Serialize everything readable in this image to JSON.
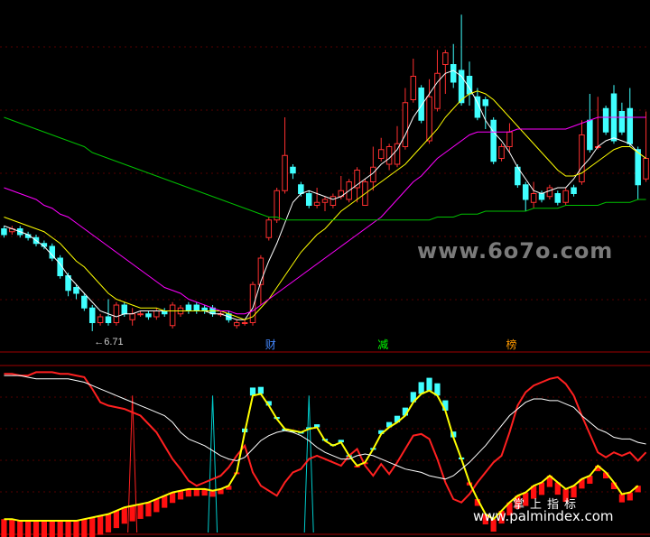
{
  "chart_data": [
    {
      "type": "candlestick",
      "title": "",
      "xlabel": "",
      "ylabel": "",
      "ylim": [
        6.0,
        18.0
      ],
      "grid": true,
      "low_annotation": "6.71",
      "candles": [
        [
          10.2,
          10.0,
          10.3,
          9.9
        ],
        [
          10.1,
          10.2,
          10.3,
          10.0
        ],
        [
          10.2,
          10.0,
          10.3,
          9.9
        ],
        [
          10.0,
          9.9,
          10.1,
          9.8
        ],
        [
          9.9,
          9.7,
          10.0,
          9.6
        ],
        [
          9.7,
          9.6,
          9.8,
          9.5
        ],
        [
          9.6,
          9.2,
          9.7,
          9.1
        ],
        [
          9.2,
          8.6,
          9.3,
          8.5
        ],
        [
          8.6,
          8.1,
          8.7,
          7.9
        ],
        [
          8.2,
          8.0,
          8.3,
          7.8
        ],
        [
          7.9,
          7.5,
          8.0,
          7.4
        ],
        [
          7.5,
          7.0,
          7.6,
          6.71
        ],
        [
          7.0,
          7.2,
          7.3,
          6.9
        ],
        [
          7.2,
          7.0,
          7.8,
          6.9
        ],
        [
          7.0,
          7.6,
          7.7,
          6.9
        ],
        [
          7.6,
          7.3,
          7.7,
          7.2
        ],
        [
          7.1,
          7.3,
          7.5,
          6.9
        ],
        [
          7.3,
          7.3,
          7.4,
          7.2
        ],
        [
          7.3,
          7.2,
          7.4,
          7.1
        ],
        [
          7.2,
          7.4,
          7.5,
          7.1
        ],
        [
          7.4,
          7.3,
          7.5,
          7.2
        ],
        [
          6.9,
          7.6,
          7.7,
          6.8
        ],
        [
          7.3,
          7.5,
          7.6,
          7.2
        ],
        [
          7.6,
          7.4,
          7.7,
          7.3
        ],
        [
          7.6,
          7.4,
          7.7,
          7.3
        ],
        [
          7.5,
          7.4,
          7.6,
          7.3
        ],
        [
          7.5,
          7.3,
          7.6,
          7.2
        ],
        [
          7.3,
          7.3,
          7.4,
          7.2
        ],
        [
          7.3,
          7.1,
          7.4,
          7.0
        ],
        [
          6.9,
          7.0,
          7.1,
          6.8
        ],
        [
          7.0,
          7.0,
          7.1,
          6.9
        ],
        [
          7.0,
          8.3,
          8.4,
          6.9
        ],
        [
          8.3,
          9.2,
          9.3,
          7.6
        ],
        [
          9.9,
          10.5,
          10.6,
          9.8
        ],
        [
          10.5,
          11.5,
          11.6,
          10.4
        ],
        [
          11.5,
          12.7,
          14.0,
          11.4
        ],
        [
          12.3,
          12.1,
          12.4,
          11.9
        ],
        [
          11.7,
          11.4,
          11.8,
          11.3
        ],
        [
          11.4,
          11.0,
          11.5,
          10.9
        ],
        [
          11.0,
          11.1,
          11.6,
          10.9
        ],
        [
          11.1,
          11.2,
          11.3,
          10.8
        ],
        [
          11.0,
          11.3,
          11.4,
          10.9
        ],
        [
          11.3,
          11.5,
          12.0,
          11.2
        ],
        [
          11.2,
          11.8,
          11.9,
          11.1
        ],
        [
          11.6,
          12.2,
          12.3,
          11.1
        ],
        [
          11.0,
          11.8,
          11.9,
          11.0
        ],
        [
          11.8,
          12.3,
          13.0,
          11.5
        ],
        [
          12.6,
          12.9,
          13.3,
          12.5
        ],
        [
          12.4,
          13.0,
          13.1,
          12.2
        ],
        [
          12.4,
          13.1,
          13.7,
          12.3
        ],
        [
          13.0,
          14.5,
          15.0,
          12.9
        ],
        [
          14.6,
          15.4,
          16.0,
          14.5
        ],
        [
          15.0,
          13.9,
          15.1,
          13.8
        ],
        [
          13.2,
          14.7,
          15.3,
          13.1
        ],
        [
          14.3,
          15.5,
          16.3,
          14.2
        ],
        [
          15.8,
          16.2,
          16.3,
          14.8
        ],
        [
          15.8,
          15.2,
          16.5,
          15.0
        ],
        [
          15.6,
          14.5,
          17.5,
          14.4
        ],
        [
          15.4,
          14.8,
          15.9,
          14.4
        ],
        [
          14.7,
          14.0,
          15.0,
          13.9
        ],
        [
          14.6,
          14.4,
          14.7,
          13.6
        ],
        [
          13.9,
          12.5,
          14.0,
          12.4
        ],
        [
          12.6,
          13.0,
          13.1,
          12.5
        ],
        [
          13.0,
          13.5,
          13.8,
          12.8
        ],
        [
          12.3,
          11.7,
          12.4,
          11.6
        ],
        [
          11.7,
          11.2,
          11.8,
          10.8
        ],
        [
          11.1,
          11.4,
          11.8,
          10.9
        ],
        [
          11.4,
          11.2,
          11.5,
          11.1
        ],
        [
          11.3,
          11.6,
          11.7,
          11.2
        ],
        [
          11.4,
          11.1,
          11.5,
          11.0
        ],
        [
          11.1,
          11.5,
          11.6,
          11.0
        ],
        [
          11.6,
          11.4,
          11.7,
          11.3
        ],
        [
          11.8,
          13.4,
          13.9,
          11.7
        ],
        [
          13.9,
          12.9,
          14.8,
          12.8
        ],
        [
          13.0,
          13.0,
          14.7,
          12.9
        ],
        [
          14.3,
          13.5,
          14.4,
          13.4
        ],
        [
          14.8,
          13.2,
          15.1,
          13.1
        ],
        [
          14.2,
          13.5,
          14.5,
          13.4
        ],
        [
          14.3,
          13.1,
          15.0,
          13.0
        ],
        [
          12.9,
          11.7,
          13.0,
          11.2
        ],
        [
          11.9,
          12.6,
          14.2,
          11.8
        ]
      ],
      "ma_lines": [
        {
          "color": "#ffffff",
          "values": [
            10.3,
            10.2,
            10.1,
            10.0,
            9.8,
            9.6,
            9.3,
            9.0,
            8.6,
            8.3,
            8.0,
            7.7,
            7.4,
            7.3,
            7.2,
            7.3,
            7.3,
            7.4,
            7.4,
            7.4,
            7.4,
            7.4,
            7.4,
            7.4,
            7.4,
            7.4,
            7.3,
            7.3,
            7.2,
            7.1,
            7.1,
            7.5,
            8.4,
            9.1,
            9.7,
            10.4,
            11.1,
            11.4,
            11.5,
            11.4,
            11.3,
            11.2,
            11.3,
            11.5,
            11.7,
            11.9,
            12.1,
            12.4,
            12.6,
            12.9,
            13.4,
            14.0,
            14.4,
            14.8,
            15.2,
            15.5,
            15.6,
            15.4,
            15.0,
            14.5,
            13.9,
            13.5,
            13.2,
            12.8,
            12.3,
            11.9,
            11.5,
            11.4,
            11.5,
            11.6,
            11.6,
            11.9,
            12.3,
            12.6,
            13.0,
            13.2,
            13.3,
            13.2,
            13.1,
            12.8,
            12.6
          ]
        },
        {
          "color": "#ffff00",
          "values": [
            10.6,
            10.5,
            10.4,
            10.3,
            10.2,
            10.1,
            9.9,
            9.7,
            9.4,
            9.1,
            8.9,
            8.6,
            8.3,
            8.0,
            7.8,
            7.7,
            7.6,
            7.5,
            7.5,
            7.5,
            7.4,
            7.4,
            7.4,
            7.4,
            7.4,
            7.4,
            7.4,
            7.4,
            7.3,
            7.2,
            7.1,
            7.2,
            7.5,
            7.8,
            8.2,
            8.6,
            9.0,
            9.4,
            9.7,
            10.0,
            10.2,
            10.5,
            10.8,
            11.0,
            11.2,
            11.4,
            11.6,
            11.8,
            12.0,
            12.2,
            12.4,
            12.7,
            13.0,
            13.3,
            13.6,
            14.0,
            14.3,
            14.6,
            14.8,
            14.9,
            14.8,
            14.6,
            14.3,
            14.0,
            13.7,
            13.4,
            13.1,
            12.8,
            12.5,
            12.2,
            12.0,
            12.0,
            12.1,
            12.3,
            12.5,
            12.7,
            12.9,
            13.0,
            13.0,
            12.8,
            12.6
          ]
        },
        {
          "color": "#ff00ff",
          "values": [
            11.6,
            11.5,
            11.4,
            11.3,
            11.2,
            11.0,
            10.9,
            10.7,
            10.6,
            10.4,
            10.2,
            10.0,
            9.8,
            9.6,
            9.4,
            9.2,
            9.0,
            8.8,
            8.6,
            8.4,
            8.2,
            8.1,
            8.0,
            7.8,
            7.7,
            7.6,
            7.5,
            7.4,
            7.4,
            7.3,
            7.3,
            7.4,
            7.6,
            7.8,
            8.0,
            8.2,
            8.4,
            8.6,
            8.8,
            9.0,
            9.2,
            9.4,
            9.6,
            9.8,
            10.0,
            10.2,
            10.4,
            10.6,
            10.9,
            11.2,
            11.5,
            11.8,
            12.0,
            12.3,
            12.6,
            12.8,
            13.0,
            13.2,
            13.4,
            13.5,
            13.5,
            13.5,
            13.5,
            13.5,
            13.6,
            13.6,
            13.6,
            13.6,
            13.6,
            13.6,
            13.6,
            13.7,
            13.8,
            13.9,
            14.0,
            14.0,
            14.0,
            14.0,
            14.0,
            14.0,
            14.0
          ]
        },
        {
          "color": "#00c000",
          "values": [
            14.0,
            13.9,
            13.8,
            13.7,
            13.6,
            13.5,
            13.4,
            13.3,
            13.2,
            13.1,
            13.0,
            12.8,
            12.7,
            12.6,
            12.5,
            12.4,
            12.3,
            12.2,
            12.1,
            12.0,
            11.9,
            11.8,
            11.7,
            11.6,
            11.5,
            11.4,
            11.3,
            11.2,
            11.1,
            11.0,
            10.9,
            10.8,
            10.7,
            10.6,
            10.6,
            10.5,
            10.5,
            10.5,
            10.5,
            10.5,
            10.5,
            10.5,
            10.5,
            10.5,
            10.5,
            10.5,
            10.5,
            10.5,
            10.5,
            10.5,
            10.5,
            10.5,
            10.5,
            10.5,
            10.6,
            10.6,
            10.6,
            10.7,
            10.7,
            10.7,
            10.8,
            10.8,
            10.8,
            10.8,
            10.8,
            10.8,
            10.9,
            10.9,
            10.9,
            10.9,
            11.0,
            11.0,
            11.0,
            11.0,
            11.0,
            11.1,
            11.1,
            11.1,
            11.1,
            11.2,
            11.2
          ]
        }
      ],
      "markers": [
        {
          "index": 33,
          "text": "财",
          "color": "#4488ff"
        },
        {
          "index": 47,
          "text": "减",
          "color": "#00ff00"
        },
        {
          "index": 63,
          "text": "榜",
          "color": "#ff9900"
        }
      ]
    },
    {
      "type": "line",
      "title": "",
      "xlabel": "",
      "ylabel": "",
      "ylim": [
        0,
        100
      ],
      "grid": true,
      "series": [
        {
          "color": "#ff2020",
          "values": [
            95,
            95,
            94,
            94,
            96,
            96,
            96,
            95,
            95,
            94,
            93,
            86,
            78,
            76,
            75,
            74,
            72,
            70,
            65,
            60,
            52,
            44,
            38,
            31,
            28,
            30,
            32,
            34,
            39,
            46,
            52,
            36,
            28,
            25,
            22,
            30,
            36,
            38,
            44,
            46,
            44,
            42,
            40,
            46,
            50,
            40,
            34,
            41,
            35,
            42,
            50,
            58,
            59,
            56,
            44,
            30,
            20,
            18,
            23,
            30,
            36,
            42,
            46,
            60,
            76,
            84,
            88,
            90,
            92,
            93,
            89,
            82,
            70,
            59,
            48,
            45,
            48,
            46,
            48,
            43,
            48
          ]
        },
        {
          "color": "#ffff00",
          "values": [
            8,
            8,
            7,
            7,
            7,
            7,
            7,
            7,
            7,
            7,
            8,
            9,
            10,
            11,
            13,
            15,
            16,
            17,
            18,
            20,
            22,
            24,
            25,
            26,
            26,
            26,
            25,
            26,
            28,
            36,
            60,
            82,
            83,
            76,
            68,
            62,
            61,
            60,
            62,
            63,
            55,
            52,
            54,
            46,
            40,
            42,
            50,
            59,
            63,
            66,
            70,
            78,
            83,
            85,
            82,
            73,
            57,
            44,
            30,
            20,
            11,
            8,
            13,
            18,
            22,
            24,
            28,
            30,
            34,
            30,
            26,
            28,
            32,
            34,
            40,
            36,
            30,
            23,
            24,
            28
          ]
        },
        {
          "color": "#ffffff",
          "values": [
            94,
            94,
            94,
            93,
            92,
            92,
            92,
            92,
            92,
            91,
            90,
            88,
            86,
            84,
            82,
            80,
            78,
            76,
            74,
            72,
            70,
            66,
            60,
            56,
            54,
            52,
            49,
            46,
            44,
            43,
            45,
            50,
            55,
            58,
            60,
            61,
            60,
            58,
            55,
            51,
            48,
            46,
            44,
            44,
            46,
            47,
            46,
            44,
            42,
            40,
            38,
            37,
            36,
            34,
            33,
            32,
            34,
            38,
            42,
            47,
            52,
            58,
            64,
            70,
            74,
            78,
            80,
            80,
            79,
            79,
            77,
            75,
            70,
            66,
            62,
            60,
            57,
            56,
            56,
            54,
            53
          ]
        },
        {
          "color": "#00cccc",
          "type": "spikes",
          "indices": [
            26,
            38
          ]
        },
        {
          "color": "#ff2020",
          "type": "spikes",
          "indices": [
            16
          ]
        }
      ]
    }
  ],
  "watermarks": {
    "mid": "www.6o7o.com",
    "brand": "掌上指标",
    "url": "www.palmindex.com"
  }
}
